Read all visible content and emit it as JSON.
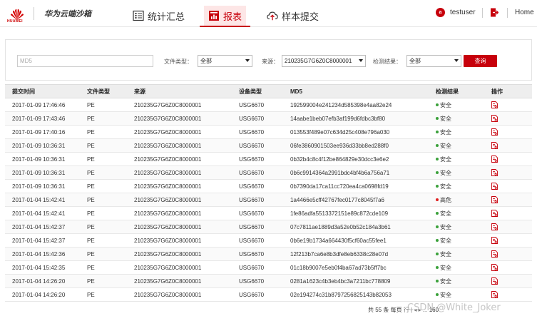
{
  "header": {
    "logo_text": "HUAWEI",
    "product_name": "华为云端沙箱",
    "tabs": [
      {
        "label": "统计汇总",
        "icon": "stats-list-icon",
        "active": false
      },
      {
        "label": "报表",
        "icon": "report-icon",
        "active": true
      },
      {
        "label": "样本提交",
        "icon": "cloud-upload-icon",
        "active": false
      }
    ],
    "user_initial": "a",
    "username": "testuser",
    "home_label": "Home"
  },
  "filters": {
    "md5_placeholder": "MD5",
    "file_type_label": "文件类型：",
    "file_type_value": "全部",
    "source_label": "来源：",
    "source_value": "210235G7G6Z0C8000001",
    "result_label": "检测结果：",
    "result_value": "全部",
    "query_label": "查询"
  },
  "table": {
    "columns": [
      "提交时间",
      "文件类型",
      "来源",
      "设备类型",
      "MD5",
      "检测结果",
      "操作"
    ],
    "rows": [
      [
        "2017-01-09 17:46:46",
        "PE",
        "210235G7G6Z0C8000001",
        "USG6670",
        "192599004e241234d585398e4aa82e24",
        "安全"
      ],
      [
        "2017-01-09 17:43:46",
        "PE",
        "210235G7G6Z0C8000001",
        "USG6670",
        "14aabe1beb07efb3af199d6fdbc3bf80",
        "安全"
      ],
      [
        "2017-01-09 17:40:16",
        "PE",
        "210235G7G6Z0C8000001",
        "USG6670",
        "013553f489e07c634d25c408e796a030",
        "安全"
      ],
      [
        "2017-01-09 10:36:31",
        "PE",
        "210235G7G6Z0C8000001",
        "USG6670",
        "06fe3860901503ee936d33bb8ed288f0",
        "安全"
      ],
      [
        "2017-01-09 10:36:31",
        "PE",
        "210235G7G6Z0C8000001",
        "USG6670",
        "0b32b4c8c4f12be864829e30dcc3e6e2",
        "安全"
      ],
      [
        "2017-01-09 10:36:31",
        "PE",
        "210235G7G6Z0C8000001",
        "USG6670",
        "0b6c9914364a2991bdc4bf4b6a756a71",
        "安全"
      ],
      [
        "2017-01-09 10:36:31",
        "PE",
        "210235G7G6Z0C8000001",
        "USG6670",
        "0b7390da17ca11cc720ea4ca0698fd19",
        "安全"
      ],
      [
        "2017-01-04 15:42:41",
        "PE",
        "210235G7G6Z0C8000001",
        "USG6670",
        "1a4466e5cff42767fec0177c8045f7a6",
        "高危"
      ],
      [
        "2017-01-04 15:42:41",
        "PE",
        "210235G7G6Z0C8000001",
        "USG6670",
        "1fe86adfa5513372151e89c872cde109",
        "安全"
      ],
      [
        "2017-01-04 15:42:37",
        "PE",
        "210235G7G6Z0C8000001",
        "USG6670",
        "07c7811ae1889d3a52e0b52c184a3b61",
        "安全"
      ],
      [
        "2017-01-04 15:42:37",
        "PE",
        "210235G7G6Z0C8000001",
        "USG6670",
        "0b6e19b1734a664430f5cf60ac55fee1",
        "安全"
      ],
      [
        "2017-01-04 15:42:36",
        "PE",
        "210235G7G6Z0C8000001",
        "USG6670",
        "12f213b7ca6e8b3dfe8eb6338c28e07d",
        "安全"
      ],
      [
        "2017-01-04 15:42:35",
        "PE",
        "210235G7G6Z0C8000001",
        "USG6670",
        "01c18b9007e5eb0f4ba67ad73b5ff7bc",
        "安全"
      ],
      [
        "2017-01-04 14:26:20",
        "PE",
        "210235G7G6Z0C8000001",
        "USG6670",
        "0281a1623c4b3eb4bc3a7211bc778809",
        "安全"
      ],
      [
        "2017-01-04 14:26:20",
        "PE",
        "210235G7G6Z0C8000001",
        "USG6670",
        "02e194274c31b8797256825143b82053",
        "安全"
      ]
    ],
    "action_icon": "report-detail-icon"
  },
  "pager": {
    "text_left": "共 55 条 每页",
    "text_mid": "行 | ◂ ▸ ...",
    "text_right": "160"
  },
  "watermark": "CSDN @White_Joker",
  "colors": {
    "brand_red": "#c7000b",
    "safe_green": "#3aa13a",
    "danger_red": "#e02020",
    "header_bg": "#eeeeee"
  }
}
